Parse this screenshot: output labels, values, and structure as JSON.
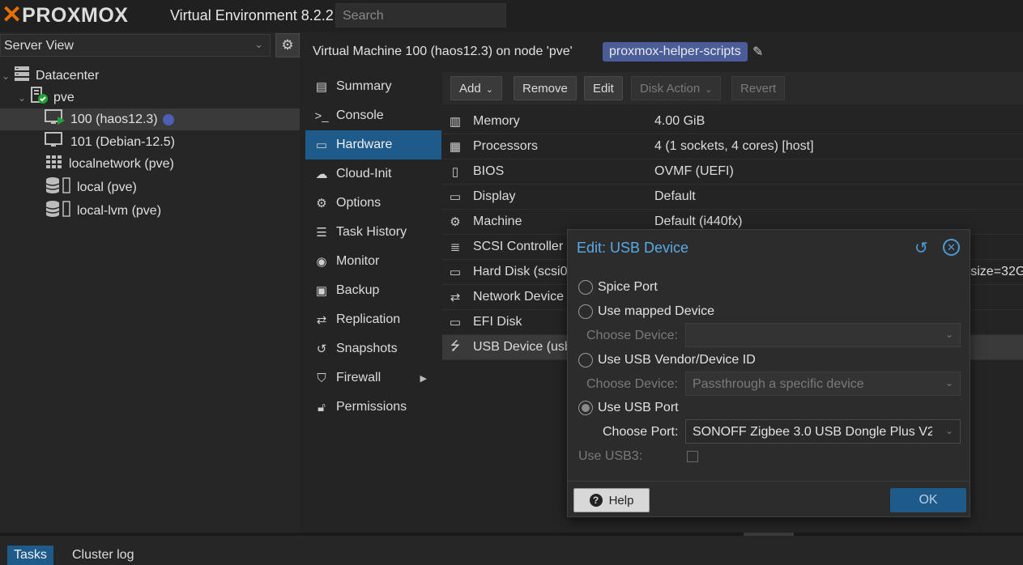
{
  "header": {
    "logo_text": "PROXMOX",
    "product": "Virtual Environment 8.2.2",
    "search_placeholder": "Search"
  },
  "left_panel": {
    "view": "Server View",
    "tree": [
      {
        "label": "Datacenter",
        "icon": "datacenter-icon"
      },
      {
        "label": "pve",
        "icon": "node-online-icon"
      },
      {
        "label": "100 (haos12.3)",
        "icon": "vm-running-icon",
        "selected": true
      },
      {
        "label": "101 (Debian-12.5)",
        "icon": "vm-stopped-icon"
      },
      {
        "label": "localnetwork (pve)",
        "icon": "sdn-zone-icon"
      },
      {
        "label": "local (pve)",
        "icon": "storage-icon"
      },
      {
        "label": "local-lvm (pve)",
        "icon": "storage-icon"
      }
    ]
  },
  "content": {
    "title": "Virtual Machine 100 (haos12.3) on node 'pve'",
    "tag": "proxmox-helper-scripts",
    "nav": [
      {
        "label": "Summary",
        "icon": "book-icon"
      },
      {
        "label": "Console",
        "icon": "terminal-icon"
      },
      {
        "label": "Hardware",
        "icon": "monitor-icon",
        "active": true
      },
      {
        "label": "Cloud-Init",
        "icon": "cloud-icon"
      },
      {
        "label": "Options",
        "icon": "gear-icon"
      },
      {
        "label": "Task History",
        "icon": "list-icon"
      },
      {
        "label": "Monitor",
        "icon": "eye-icon"
      },
      {
        "label": "Backup",
        "icon": "floppy-icon"
      },
      {
        "label": "Replication",
        "icon": "retweet-icon"
      },
      {
        "label": "Snapshots",
        "icon": "history-icon"
      },
      {
        "label": "Firewall",
        "icon": "shield-icon"
      },
      {
        "label": "Permissions",
        "icon": "unlock-icon"
      }
    ],
    "toolbar": {
      "add": "Add",
      "remove": "Remove",
      "edit": "Edit",
      "disk_action": "Disk Action",
      "revert": "Revert"
    },
    "hardware": [
      {
        "name": "Memory",
        "value": "4.00 GiB",
        "icon": "memory-icon"
      },
      {
        "name": "Processors",
        "value": "4 (1 sockets, 4 cores) [host]",
        "icon": "cpu-icon"
      },
      {
        "name": "BIOS",
        "value": "OVMF (UEFI)",
        "icon": "microchip-icon"
      },
      {
        "name": "Display",
        "value": "Default",
        "icon": "desktop-icon"
      },
      {
        "name": "Machine",
        "value": "Default (i440fx)",
        "icon": "cogs-icon"
      },
      {
        "name": "SCSI Controller",
        "value": "",
        "icon": "database-icon"
      },
      {
        "name": "Hard Disk (scsi0)",
        "value": "on,size=32G",
        "icon": "hdd-icon"
      },
      {
        "name": "Network Device",
        "value": "",
        "icon": "exchange-icon"
      },
      {
        "name": "EFI Disk",
        "value": "",
        "icon": "hdd-icon"
      },
      {
        "name": "USB Device (usb0)",
        "value": "",
        "icon": "usb-icon",
        "selected": true
      }
    ]
  },
  "dialog": {
    "title": "Edit: USB Device",
    "options": {
      "spice": "Spice Port",
      "mapped": "Use mapped Device",
      "vendor": "Use USB Vendor/Device ID",
      "port": "Use USB Port"
    },
    "choose_device_label": "Choose Device:",
    "mapped_device_value": "",
    "vendor_device_value": "Passthrough a specific device",
    "choose_port_label": "Choose Port:",
    "port_value": "SONOFF Zigbee 3.0 USB Dongle Plus V2",
    "usb3_label": "Use USB3:",
    "help": "Help",
    "ok": "OK"
  },
  "bottom": {
    "tasks": "Tasks",
    "cluster_log": "Cluster log"
  }
}
